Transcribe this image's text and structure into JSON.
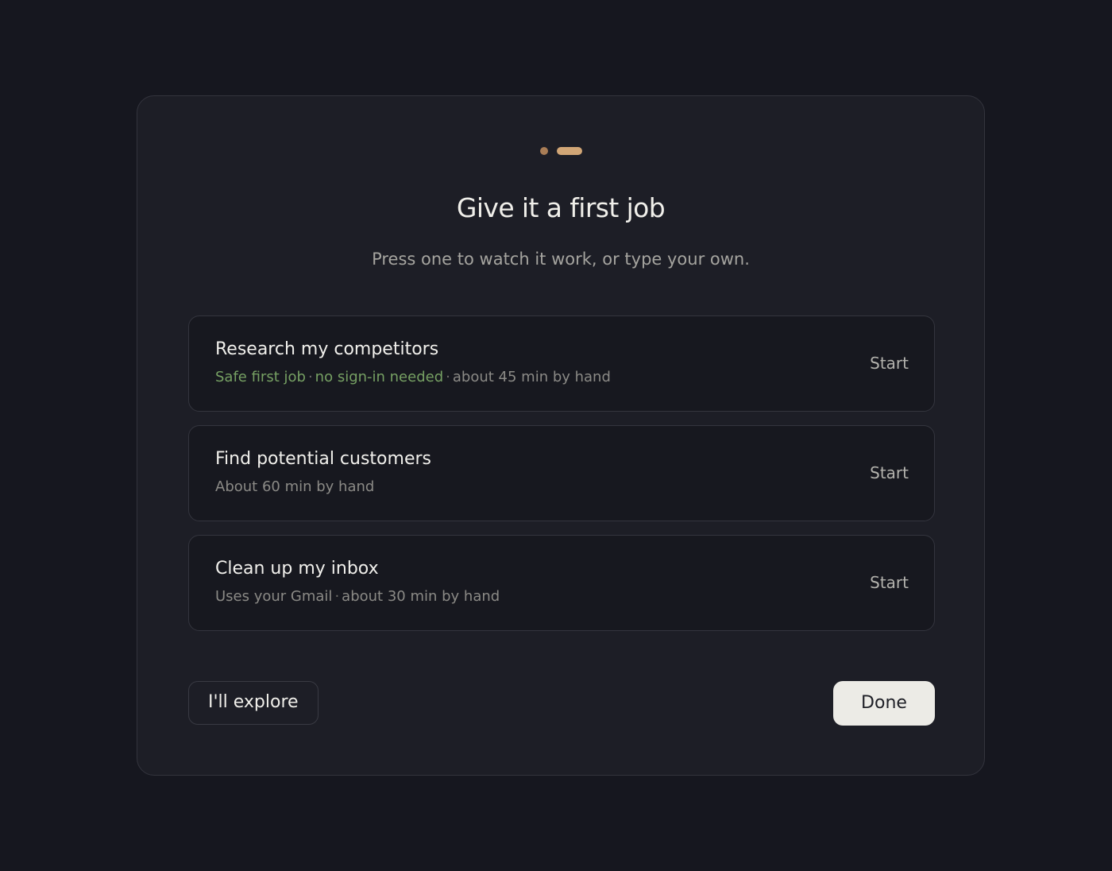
{
  "dialog": {
    "step_indicator": {
      "total_steps": 2,
      "current_step": 2
    },
    "title": "Give it a first job",
    "subtitle": "Press one to watch it work, or type your own.",
    "jobs": [
      {
        "title": "Research my competitors",
        "meta_highlight_1": "Safe first job",
        "meta_highlight_2": "no sign-in needed",
        "meta_plain": "about 45 min by hand",
        "action": "Start"
      },
      {
        "title": "Find potential customers",
        "meta_plain": "About 60 min by hand",
        "action": "Start"
      },
      {
        "title": "Clean up my inbox",
        "meta_part_1": "Uses your Gmail",
        "meta_part_2": "about 30 min by hand",
        "action": "Start"
      }
    ],
    "separator": "·",
    "secondary_button": "I'll explore",
    "primary_button": "Done"
  },
  "colors": {
    "background": "#16171f",
    "dialog": "#1d1e26",
    "accent": "#d1a676",
    "highlight_green": "#76a063",
    "primary_button_bg": "#ecebe6"
  }
}
